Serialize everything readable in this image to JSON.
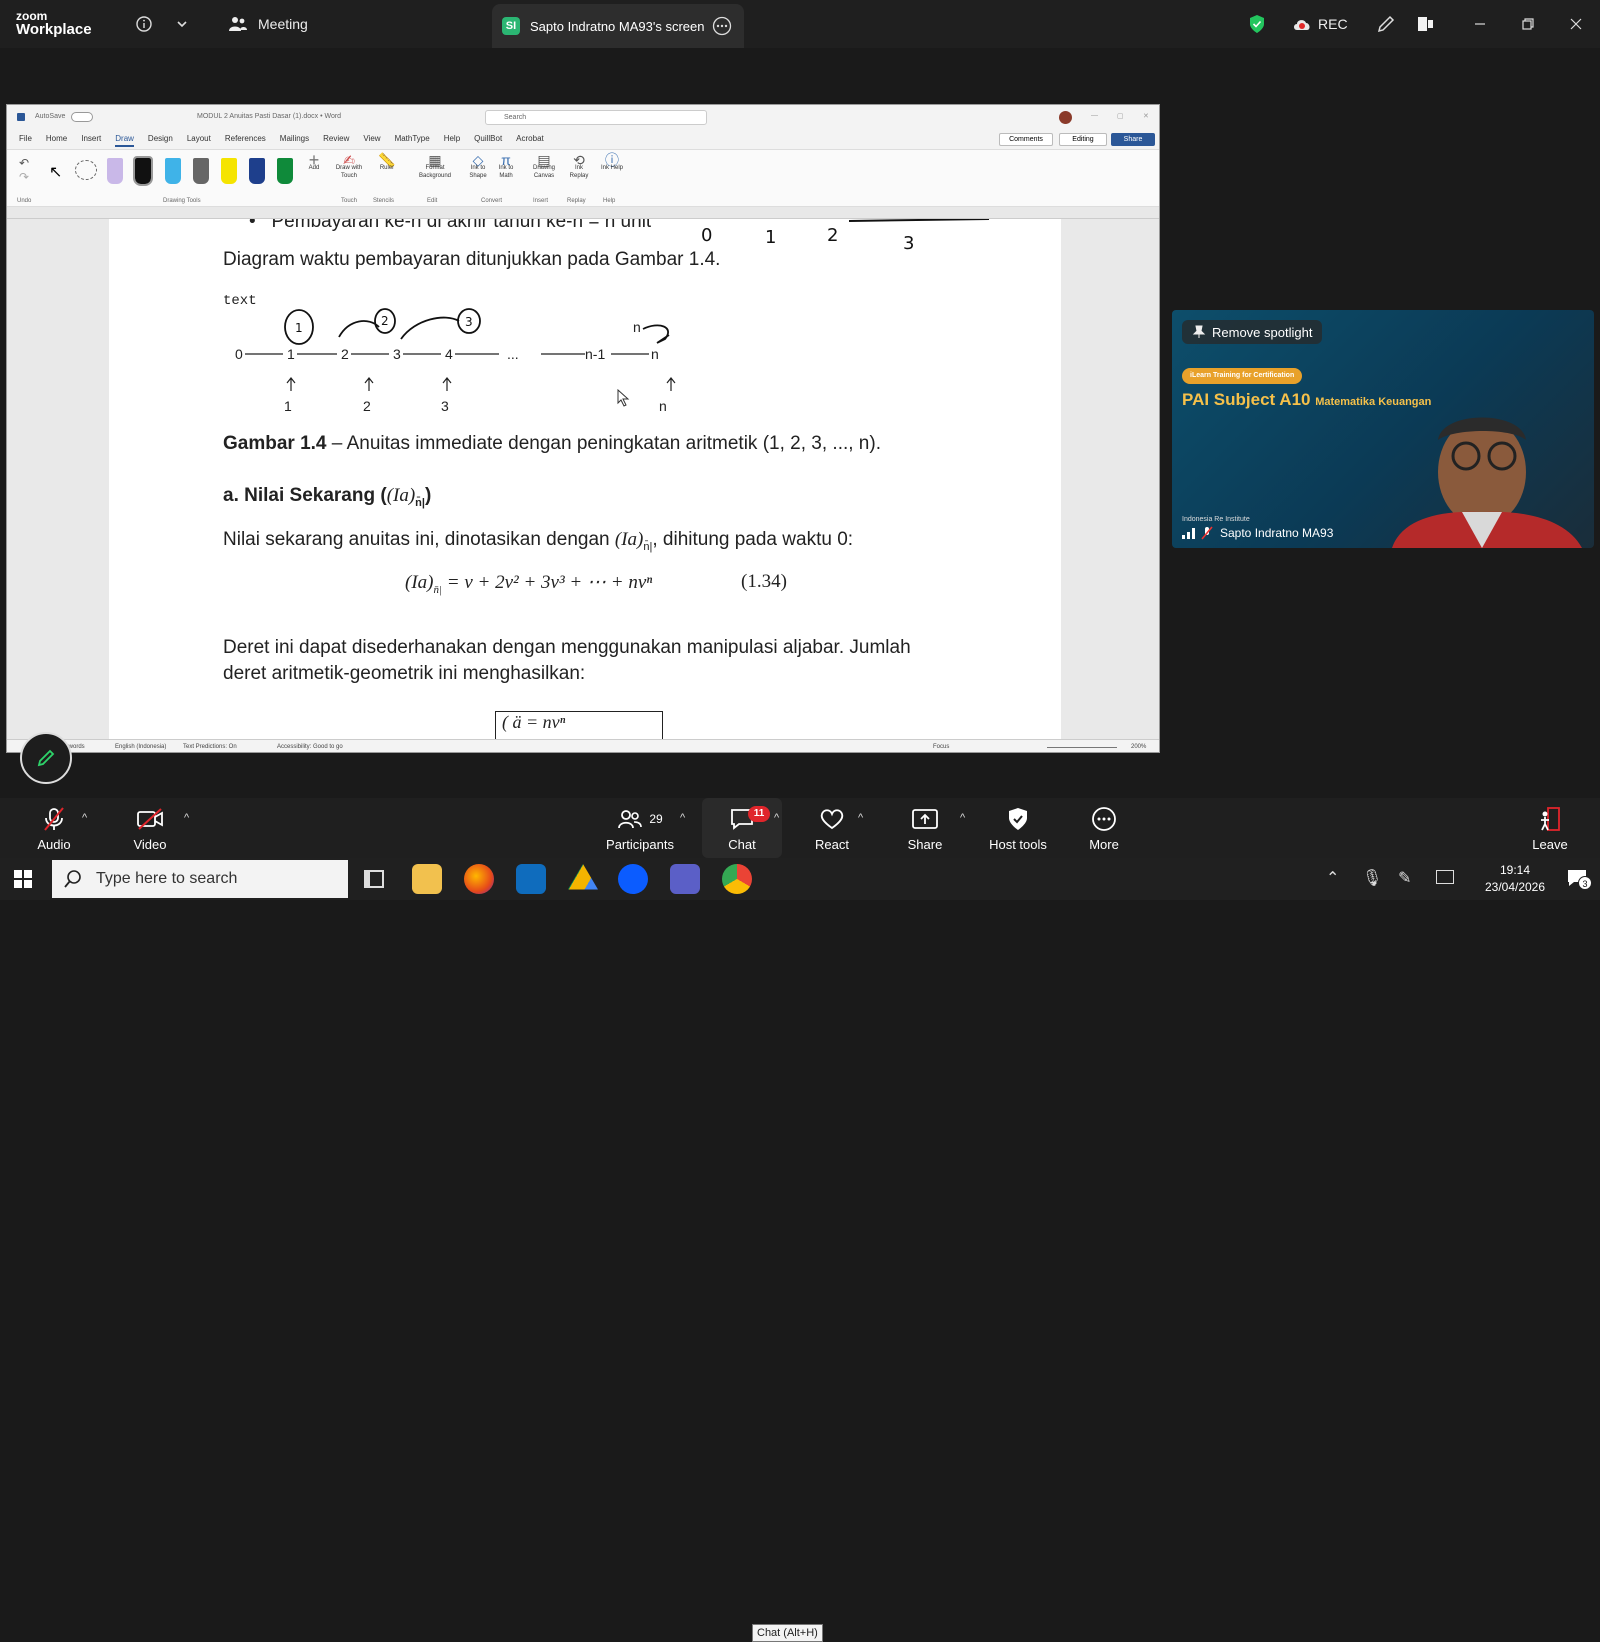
{
  "zoom": {
    "logo_line1": "zoom",
    "logo_line2": "Workplace",
    "meeting_label": "Meeting",
    "share_tab_label": "Sapto Indratno MA93's screen",
    "share_badge": "SI",
    "rec_label": "REC"
  },
  "word": {
    "title_autosave": "AutoSave",
    "title_doc": "MODUL 2 Anuitas Pasti Dasar (1).docx • Word",
    "search_placeholder": "Search",
    "menu": [
      "File",
      "Home",
      "Insert",
      "Draw",
      "Design",
      "Layout",
      "References",
      "Mailings",
      "Review",
      "View",
      "MathType",
      "Help",
      "QuillBot",
      "Acrobat"
    ],
    "menu_active": "Draw",
    "comments_btn": "Comments",
    "editing_btn": "Editing",
    "share_btn": "Share",
    "ribbon": {
      "undo": "Undo",
      "drawing_tools": "Drawing Tools",
      "add": "Add",
      "draw_with_touch": "Draw with Touch",
      "touch": "Touch",
      "ruler": "Ruler",
      "stencils": "Stencils",
      "format_background": "Format Background",
      "edit": "Edit",
      "ink_to_shape": "Ink to Shape",
      "ink_to_math": "Ink to Math",
      "convert": "Convert",
      "drawing_canvas": "Drawing Canvas",
      "insert": "Insert",
      "ink_replay": "Ink Replay",
      "replay": "Replay",
      "ink_help": "Ink Help",
      "help": "Help"
    },
    "status": {
      "words": "966 words",
      "language": "English (Indonesia)",
      "predictions": "Text Predictions: On",
      "accessibility": "Accessibility: Good to go",
      "focus": "Focus",
      "zoom": "200%"
    }
  },
  "document": {
    "bullet_partial": "Pembayaran ke-n di akhir tahun ke-n = n unit",
    "intro": "Diagram waktu pembayaran ditunjukkan pada Gambar 1.4.",
    "diagram_label": "text",
    "timeline_nodes": [
      "0",
      "1",
      "2",
      "3",
      "4",
      "...",
      "n-1",
      "n"
    ],
    "payments": [
      "1",
      "2",
      "3",
      "n"
    ],
    "caption_bold": "Gambar 1.4",
    "caption_rest": " – Anuitas immediate dengan peningkatan aritmetik (1, 2, 3, ..., n).",
    "section_heading": "a. Nilai Sekarang (",
    "section_heading_math": "(Ia)",
    "section_heading_sub": "n̄|",
    "section_heading_end": ")",
    "para1_start": "Nilai sekarang anuitas ini, dinotasikan dengan ",
    "para1_end": ", dihitung pada waktu 0:",
    "equation": "= v + 2v² + 3v³ + ⋯ + nvⁿ",
    "equation_number": "(1.34)",
    "para2_line1": "Deret ini dapat disederhanakan dengan menggunakan manipulasi aljabar. Jumlah",
    "para2_line2": "deret aritmetik-geometrik ini menghasilkan:",
    "boxed_partial": "( ä  = nvⁿ",
    "handwritten_top": [
      "0",
      "1",
      "2",
      "3"
    ]
  },
  "video": {
    "remove_spotlight": "Remove spotlight",
    "banner_tag": "iLearn Training for Certification",
    "banner_title": "PAI Subject A10",
    "banner_subtitle": "Matematika Keuangan",
    "institute": "Indonesia Re Institute",
    "participant_name": "Sapto Indratno MA93"
  },
  "toolbar": {
    "audio": "Audio",
    "video": "Video",
    "participants": "Participants",
    "participants_count": "29",
    "chat": "Chat",
    "chat_badge": "11",
    "chat_tooltip": "Chat (Alt+H)",
    "react": "React",
    "share": "Share",
    "host_tools": "Host tools",
    "more": "More",
    "leave": "Leave"
  },
  "taskbar": {
    "search_placeholder": "Type here to search",
    "time": "19:14",
    "date": "23/04/2026",
    "notification_count": "3"
  }
}
